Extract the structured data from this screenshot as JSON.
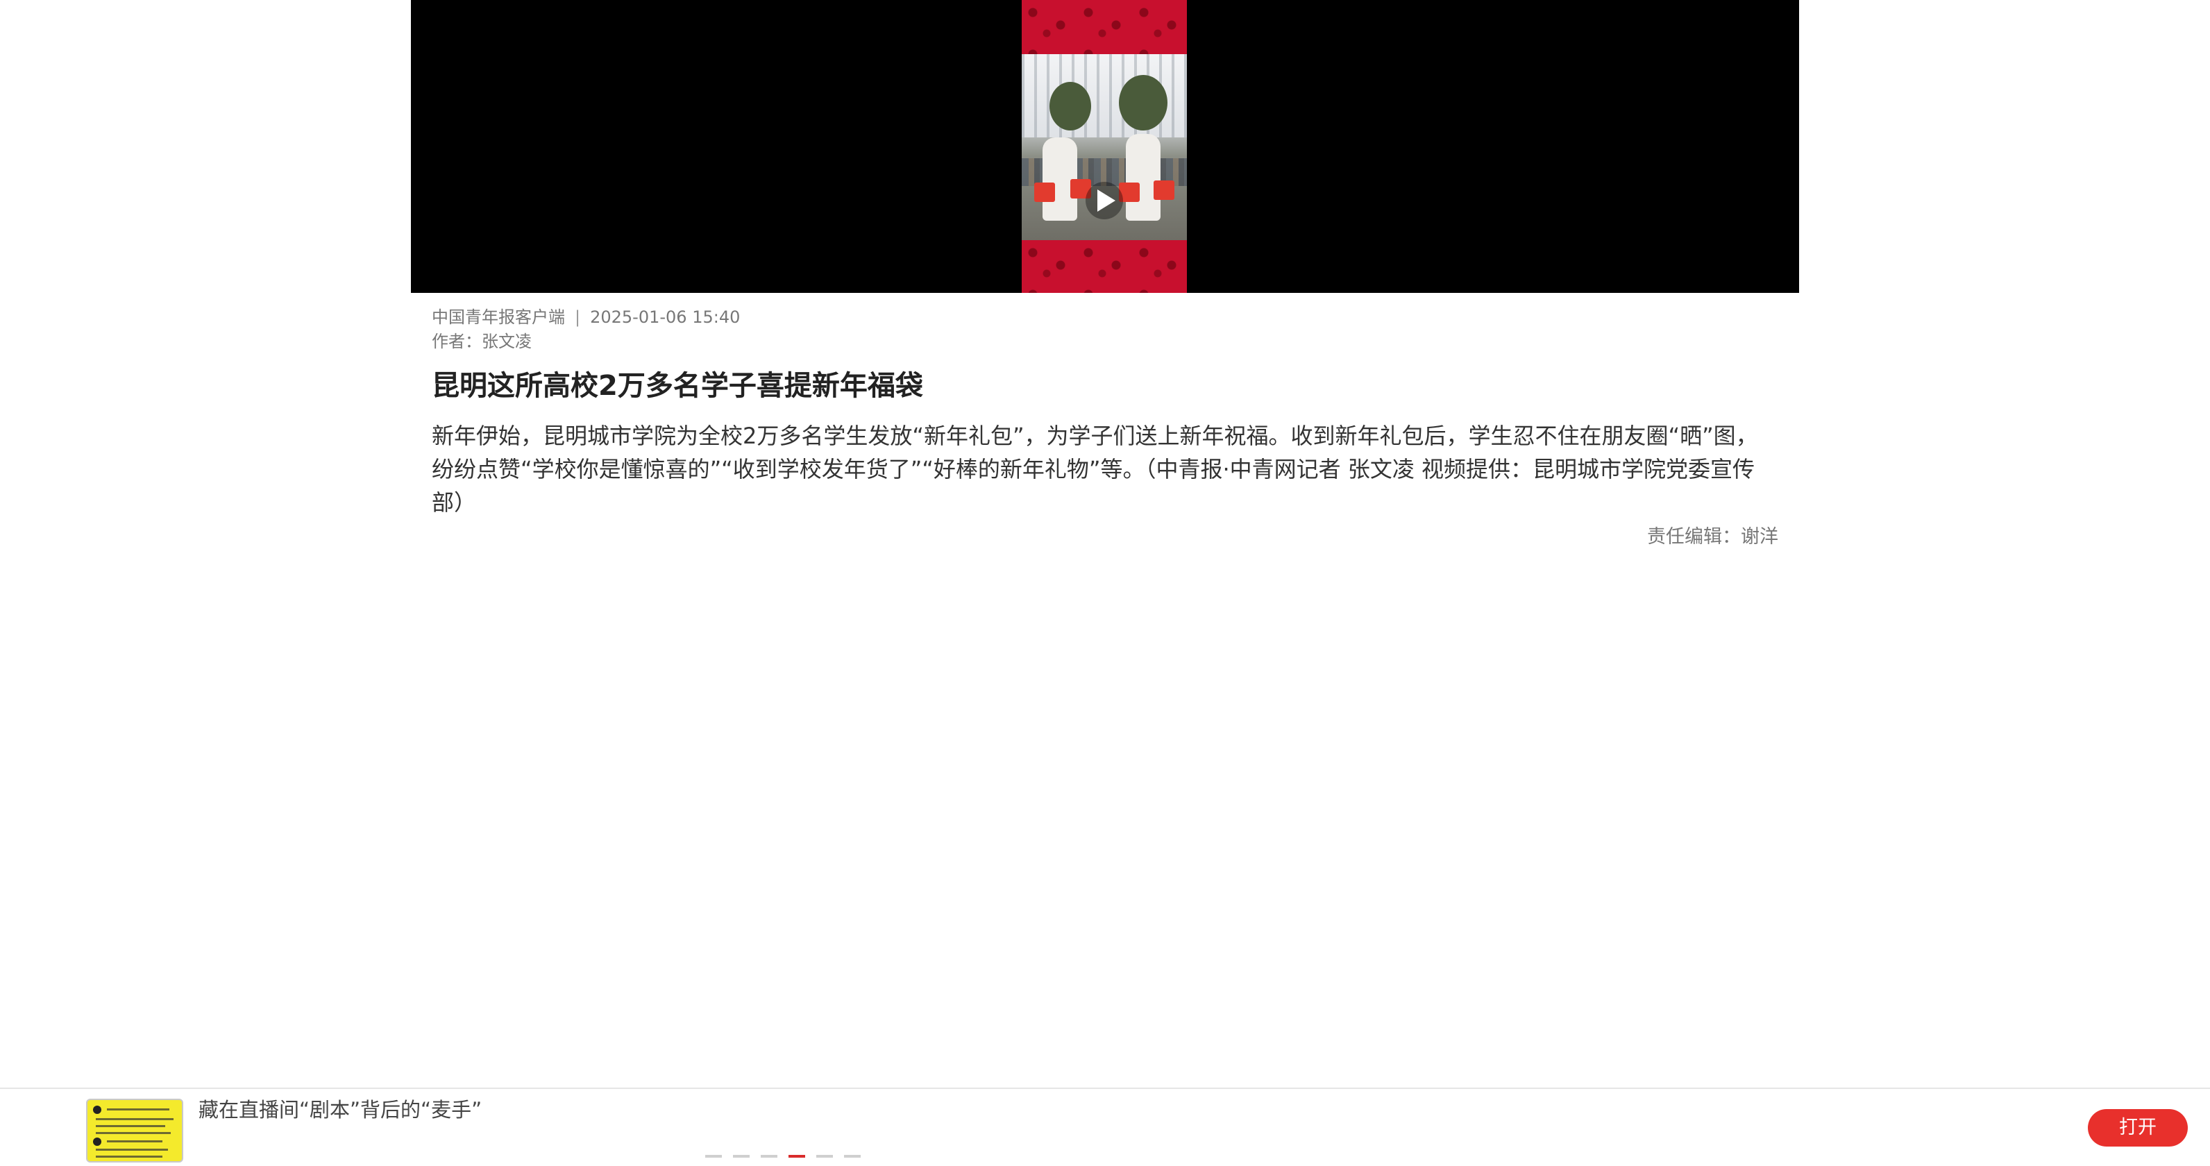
{
  "article": {
    "source": "中国青年报客户端",
    "separator": "|",
    "datetime": "2025-01-06 15:40",
    "author": "作者：张文凌",
    "title": "昆明这所高校2万多名学子喜提新年福袋",
    "body": "新年伊始，昆明城市学院为全校2万多名学生发放“新年礼包”，为学子们送上新年祝福。收到新年礼包后，学生忍不住在朋友圈“晒”图，纷纷点赞“学校你是懂惊喜的”“收到学校发年货了”“好棒的新年礼物”等。（中青报·中青网记者 张文凌 视频提供：昆明城市学院党委宣传部）",
    "editor": "责任编辑：谢洋"
  },
  "video": {
    "play_icon": "play-icon",
    "background_color": "#000000",
    "thumb_color": "#c8102e"
  },
  "bottom_bar": {
    "promo_title": "藏在直播间“剧本”背后的“麦手”",
    "open_label": "打开",
    "carousel_total": 6,
    "carousel_active": 4,
    "accent_color": "#e8302c"
  }
}
